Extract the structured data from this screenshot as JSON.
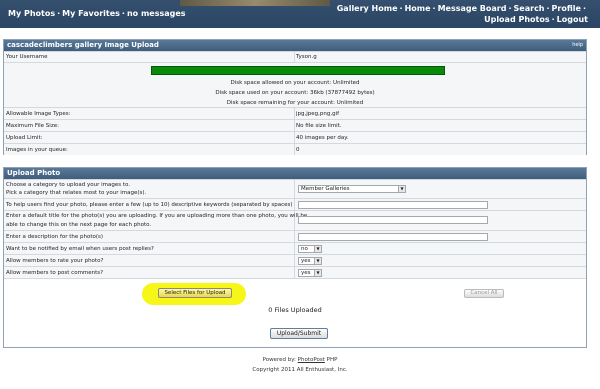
{
  "header": {
    "left_links": [
      "My Photos",
      "My Favorites",
      "no messages"
    ],
    "right_row1": [
      "Gallery Home",
      "Home",
      "Message Board",
      "Search",
      "Profile"
    ],
    "right_row2": [
      "Upload Photos",
      "Logout"
    ],
    "separator": "·"
  },
  "upload_panel": {
    "title": "cascadeclimbers gallery Image Upload",
    "help": "help",
    "username_label": "Your Username",
    "username_value": "Tyson.g",
    "disk_lines": [
      "Disk space allowed on your account: Unlimited",
      "Disk space used on your account: 36kb (37877492 bytes)",
      "Disk space remaining for your account: Unlimited"
    ],
    "disk_usage_fraction": 1.0,
    "info_rows": [
      {
        "label": "Allowable Image Types:",
        "value": "jpg,jpeg,png,gif"
      },
      {
        "label": "Maximum File Size:",
        "value": "No file size limit."
      },
      {
        "label": "Upload Limit:",
        "value": "40 images per day."
      },
      {
        "label": "Images in your queue:",
        "value": "0"
      }
    ]
  },
  "upload_photo": {
    "title": "Upload Photo",
    "category_label_1": "Choose a category to upload your images to.",
    "category_label_2": "Pick a category that relates most to your image(s).",
    "category_value": "Member Galleries",
    "keywords_label": "To help users find your photo, please enter a few (up to 10) descriptive keywords (separated by spaces)",
    "title_label_1": "Enter a default title for the photo(s) you are uploading. If you are uploading more than one photo, you will be",
    "title_label_2": "able to change this on the next page for each photo.",
    "description_label": "Enter a description for the photo(s)",
    "notify_label": "Want to be notified by email when users post replies?",
    "notify_value": "no",
    "rate_label": "Allow members to rate your photo?",
    "rate_value": "yes",
    "comments_label": "Allow members to post comments?",
    "comments_value": "yes",
    "select_files_label": "Select Files for Upload",
    "cancel_all_label": "Cancel All",
    "files_uploaded_text": "0 Files Uploaded",
    "submit_label": "Upload/Submit"
  },
  "footer": {
    "powered_prefix": "Powered by:",
    "powered_link": "PhotoPost",
    "powered_suffix": "PHP",
    "copyright": "Copyright 2011 All Enthusiast, Inc."
  },
  "colors": {
    "header_bg": "#2f4b69",
    "panel_head": "#4a6a8c",
    "disk_bar": "#098b09",
    "highlight": "#f5f500"
  }
}
